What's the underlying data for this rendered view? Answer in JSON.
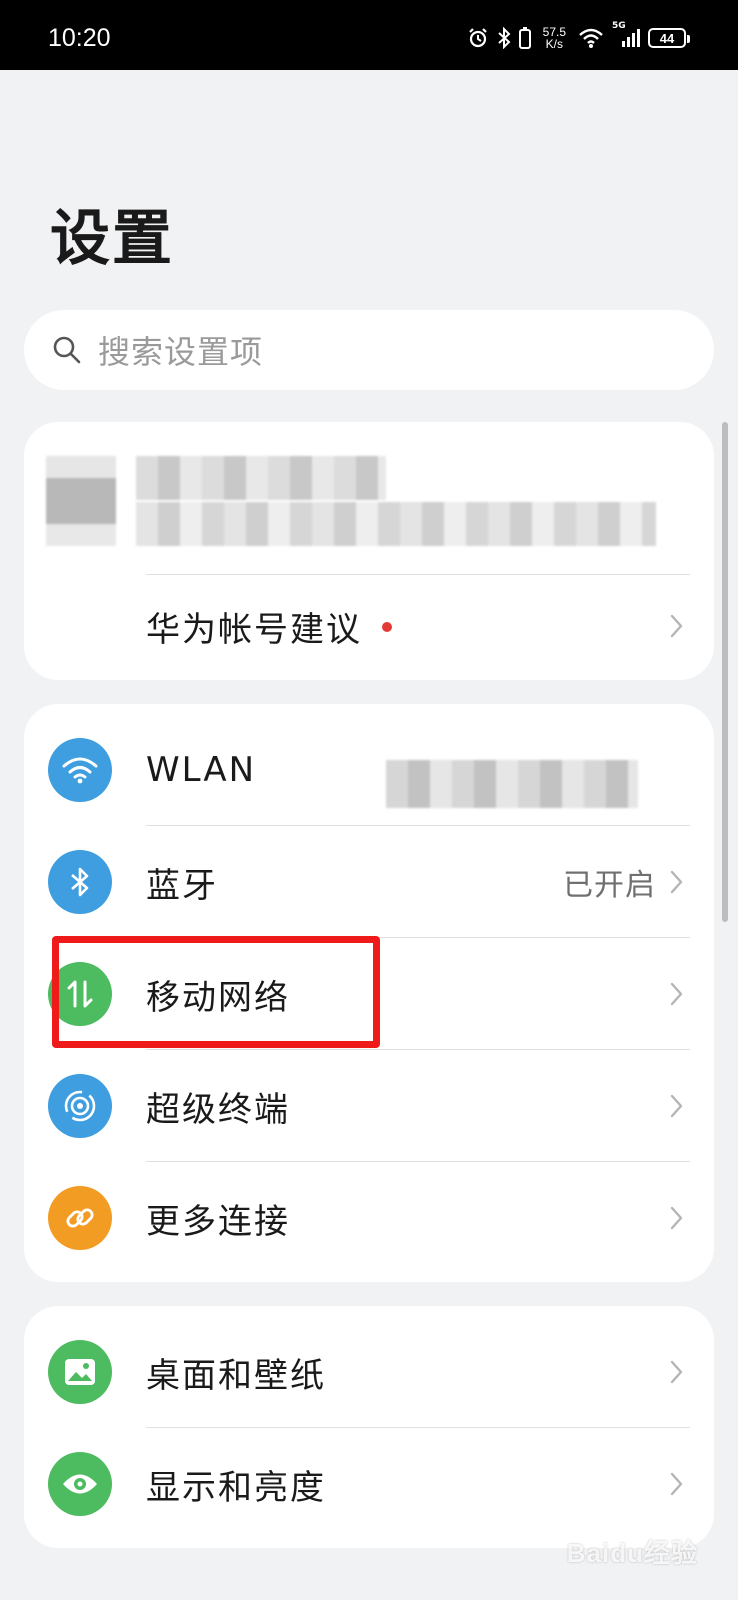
{
  "status_bar": {
    "time": "10:20",
    "net_speed_value": "57.5",
    "net_speed_unit": "K/s",
    "signal_label": "5G",
    "battery": "44"
  },
  "page": {
    "title": "设置"
  },
  "search": {
    "placeholder": "搜索设置项"
  },
  "account": {
    "suggestion_label": "华为帐号建议"
  },
  "network_section": {
    "items": [
      {
        "label": "WLAN",
        "value": "",
        "icon": "wifi-icon",
        "color": "#3f9ee0"
      },
      {
        "label": "蓝牙",
        "value": "已开启",
        "icon": "bluetooth-icon",
        "color": "#3f9ee0"
      },
      {
        "label": "移动网络",
        "value": "",
        "icon": "mobile-data-icon",
        "color": "#4dbb5f"
      },
      {
        "label": "超级终端",
        "value": "",
        "icon": "super-device-icon",
        "color": "#3f9ee0"
      },
      {
        "label": "更多连接",
        "value": "",
        "icon": "link-icon",
        "color": "#f39c24"
      }
    ]
  },
  "display_section": {
    "items": [
      {
        "label": "桌面和壁纸",
        "icon": "wallpaper-icon",
        "color": "#4dbb5f"
      },
      {
        "label": "显示和亮度",
        "icon": "eye-icon",
        "color": "#4dbb5f"
      }
    ]
  },
  "watermark": "Baidu经验"
}
